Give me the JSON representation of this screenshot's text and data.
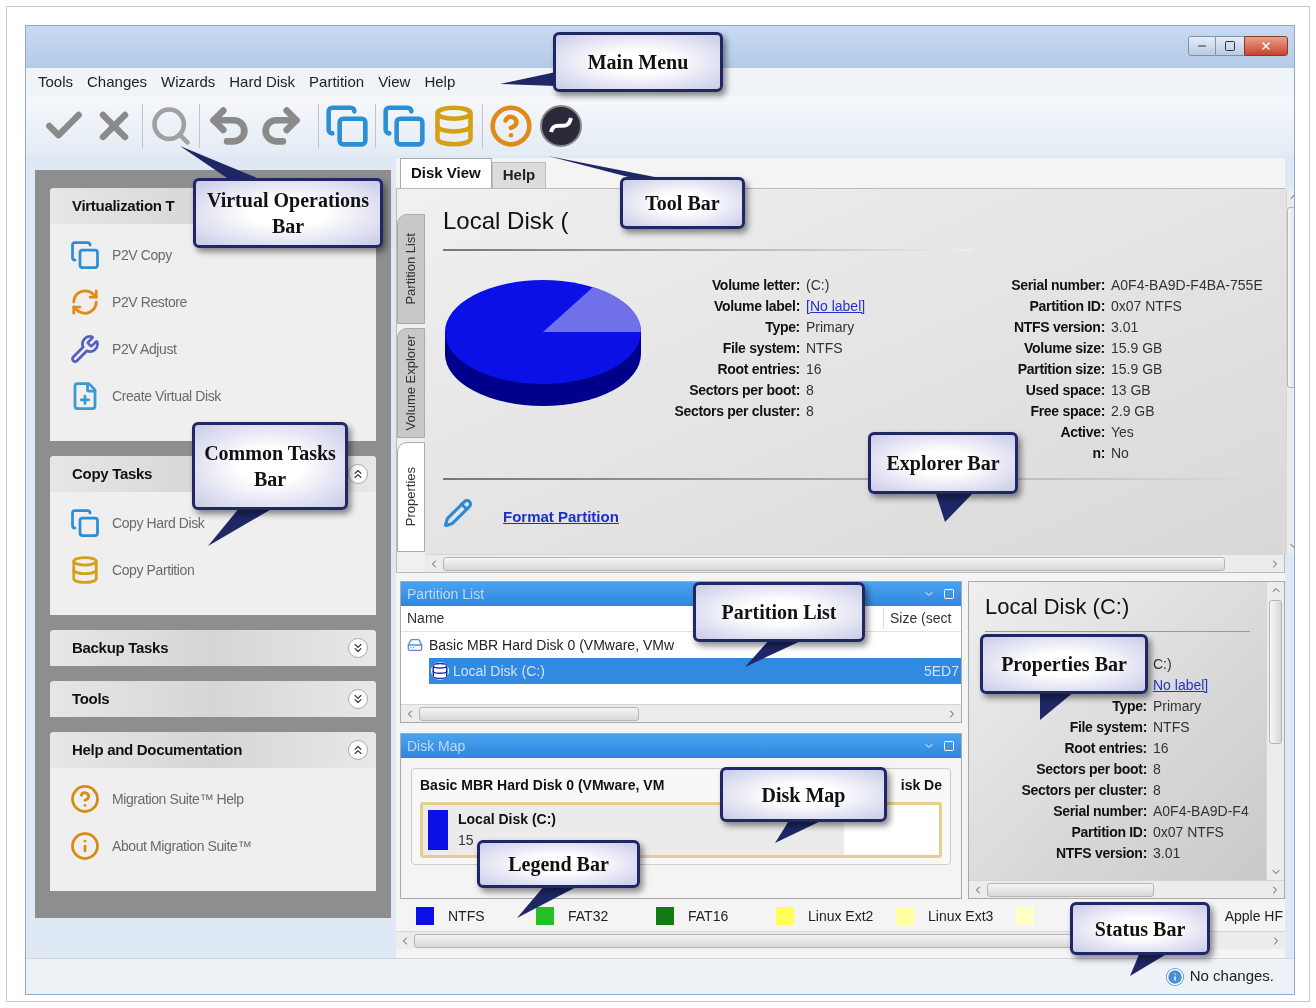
{
  "menu": [
    "Tools",
    "Changes",
    "Wizards",
    "Hard Disk",
    "Partition",
    "View",
    "Help"
  ],
  "sidebar": [
    {
      "title": "Virtualization T",
      "expanded": true,
      "items": [
        "P2V Copy",
        "P2V Restore",
        "P2V Adjust",
        "Create Virtual Disk"
      ]
    },
    {
      "title": "Copy Tasks",
      "expanded": true,
      "items": [
        "Copy Hard Disk",
        "Copy Partition"
      ]
    },
    {
      "title": "Backup Tasks",
      "expanded": false
    },
    {
      "title": "Tools",
      "expanded": false
    },
    {
      "title": "Help and Documentation",
      "expanded": true,
      "items": [
        "Migration Suite™ Help",
        "About Migration Suite™"
      ]
    }
  ],
  "tabs": [
    {
      "label": "Disk View",
      "selected": true
    },
    {
      "label": "Help",
      "selected": false
    }
  ],
  "side_tabs": [
    {
      "label": "Partition List",
      "selected": false
    },
    {
      "label": "Volume Explorer",
      "selected": false
    },
    {
      "label": "Properties",
      "selected": true
    }
  ],
  "explorer": {
    "title": "Local Disk (",
    "left": [
      {
        "label": "Volume letter:",
        "value": "(C:)",
        "kind": "text"
      },
      {
        "label": "Volume label:",
        "value": "[No label]",
        "kind": "link"
      },
      {
        "label": "Type:",
        "value": "Primary",
        "kind": "text"
      },
      {
        "label": "File system:",
        "value": "NTFS",
        "kind": "text"
      },
      {
        "label": "Root entries:",
        "value": "16",
        "kind": "text"
      },
      {
        "label": "Sectors per boot:",
        "value": "8",
        "kind": "text"
      },
      {
        "label": "Sectors per cluster:",
        "value": "8",
        "kind": "text"
      }
    ],
    "right": [
      {
        "label": "Serial number:",
        "value": "A0F4-BA9D-F4BA-755E",
        "kind": "text"
      },
      {
        "label": "Partition ID:",
        "value": "0x07 NTFS",
        "kind": "text"
      },
      {
        "label": "NTFS version:",
        "value": "3.01",
        "kind": "text"
      },
      {
        "label": "Volume size:",
        "value": "15.9 GB",
        "kind": "text"
      },
      {
        "label": "Partition size:",
        "value": "15.9 GB",
        "kind": "text"
      },
      {
        "label": "Used space:",
        "value": "13 GB",
        "kind": "text"
      },
      {
        "label": "Free space:",
        "value": "2.9 GB",
        "kind": "text"
      },
      {
        "label": "Active:",
        "value": "Yes",
        "kind": "text"
      },
      {
        "label": "n:",
        "value": "No",
        "kind": "text"
      }
    ],
    "task": "Format Partition"
  },
  "partition_list": {
    "title": "Partition List",
    "columns": [
      "Name",
      "Size (sect"
    ],
    "rows": [
      {
        "name": "Basic MBR Hard Disk 0 (VMware, VMw",
        "selected": false,
        "children": [
          {
            "name": "Local Disk (C:)",
            "size": "5ED7",
            "selected": true
          }
        ]
      }
    ]
  },
  "disk_map": {
    "title": "Disk Map",
    "disk": "Basic MBR Hard Disk 0 (VMware, VM",
    "disk_end": "isk De",
    "partition": {
      "name": "Local Disk (C:)",
      "size": "15"
    }
  },
  "properties": {
    "title": "Local Disk (C:)",
    "rows": [
      {
        "value": "C:)",
        "kind": "text"
      },
      {
        "value": "No label]",
        "kind": "link"
      },
      {
        "label": "Type:",
        "value": "Primary",
        "kind": "text"
      },
      {
        "label": "File system:",
        "value": "NTFS",
        "kind": "text"
      },
      {
        "label": "Root entries:",
        "value": "16",
        "kind": "text"
      },
      {
        "label": "Sectors per boot:",
        "value": "8",
        "kind": "text"
      },
      {
        "label": "Sectors per cluster:",
        "value": "8",
        "kind": "text"
      },
      {
        "label": "Serial number:",
        "value": "A0F4-BA9D-F4",
        "kind": "text"
      },
      {
        "label": "Partition ID:",
        "value": "0x07 NTFS",
        "kind": "text"
      },
      {
        "label": "NTFS version:",
        "value": "3.01",
        "kind": "text"
      }
    ]
  },
  "legend": [
    {
      "label": "NTFS",
      "color": "#0a10e6"
    },
    {
      "label": "FAT32",
      "color": "#22c022"
    },
    {
      "label": "FAT16",
      "color": "#147a14"
    },
    {
      "label": "Linux Ext2",
      "color": "#ffff55"
    },
    {
      "label": "Linux Ext3",
      "color": "#ffffa0"
    },
    {
      "color": "#ffffc8"
    },
    {
      "label": "Apple HF"
    }
  ],
  "status": "No changes.",
  "callouts": [
    "Main Menu",
    "Virtual Operations Bar",
    "Tool Bar",
    "Common Tasks Bar",
    "Explorer Bar",
    "Partition List",
    "Properties Bar",
    "Disk Map",
    "Legend Bar",
    "Status Bar"
  ]
}
